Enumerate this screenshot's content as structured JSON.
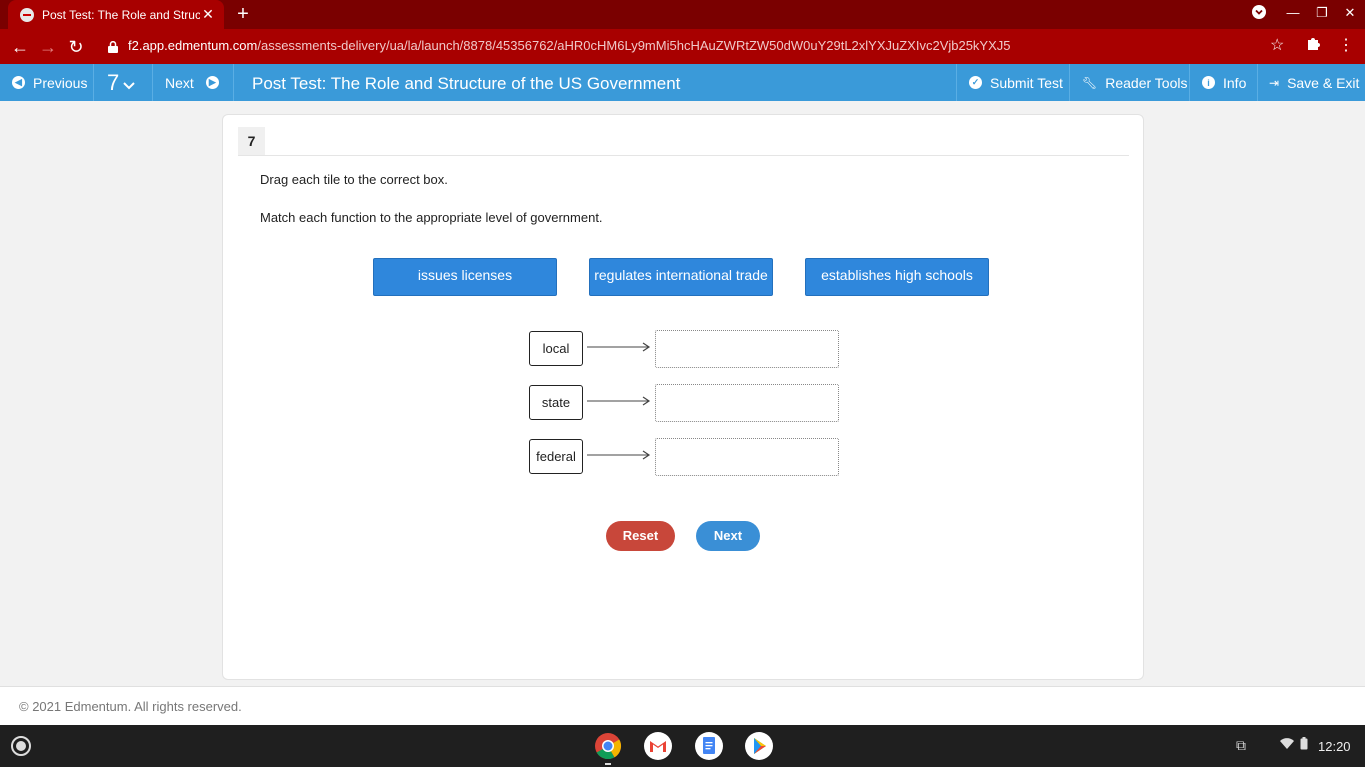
{
  "browser": {
    "tab_title": "Post Test: The Role and Structur",
    "new_tab_symbol": "+",
    "url_host": "f2.app.edmentum.com",
    "url_path": "/assessments-delivery/ua/la/launch/8878/45356762/aHR0cHM6Ly9mMi5hcHAuZWRtZW50dW0uY29tL2xlYXJuZXIvc2Vjb25kYXJ5"
  },
  "appbar": {
    "previous_label": "Previous",
    "question_number": "7",
    "next_label": "Next",
    "title": "Post Test: The Role and Structure of the US Government",
    "submit_label": "Submit Test",
    "reader_tools_label": "Reader Tools",
    "info_label": "Info",
    "save_exit_label": "Save & Exit"
  },
  "question": {
    "number": "7",
    "instruction": "Drag each tile to the correct box.",
    "prompt": "Match each function to the appropriate level of government.",
    "tiles": [
      "issues licenses",
      "regulates international trade",
      "establishes high schools"
    ],
    "targets": [
      "local",
      "state",
      "federal"
    ],
    "reset_label": "Reset",
    "next_label": "Next"
  },
  "footer": {
    "copyright": "© 2021 Edmentum. All rights reserved."
  },
  "shelf": {
    "time": "12:20"
  },
  "colors": {
    "browser_chrome": "#a80000",
    "appbar_blue": "#3a9ad9",
    "tile_blue": "#2f87dc",
    "reset_red": "#c8473a"
  }
}
